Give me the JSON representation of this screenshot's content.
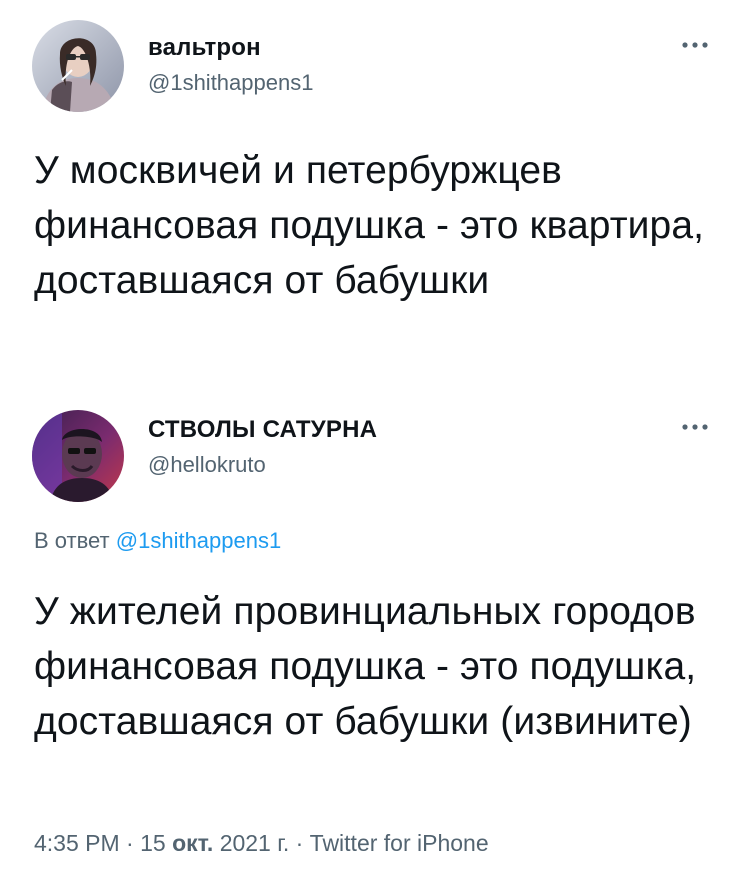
{
  "tweets": [
    {
      "author_name": "вальтрон",
      "handle": "@1shithappens1",
      "more_icon": "more-horizontal-icon",
      "text": "У москвичей и петербуржцев финансовая подушка - это квартира, доставшаяся от бабушки"
    },
    {
      "author_name": "СТВОЛЫ САТУРНА",
      "handle": "@hellokruto",
      "more_icon": "more-horizontal-icon",
      "reply_prefix": "В ответ",
      "reply_to": "@1shithappens1",
      "text": "У жителей провинциальных городов финансовая подушка - это подушка, доставшаяся от бабушки (извините)",
      "time": "4:35 PM",
      "separator": "·",
      "date_day": "15",
      "date_month": "окт.",
      "date_year": "2021 г.",
      "source": "Twitter for iPhone"
    }
  ],
  "colors": {
    "text": "#0f1419",
    "secondary": "#536471",
    "link": "#1d9bf0",
    "background": "#ffffff"
  }
}
